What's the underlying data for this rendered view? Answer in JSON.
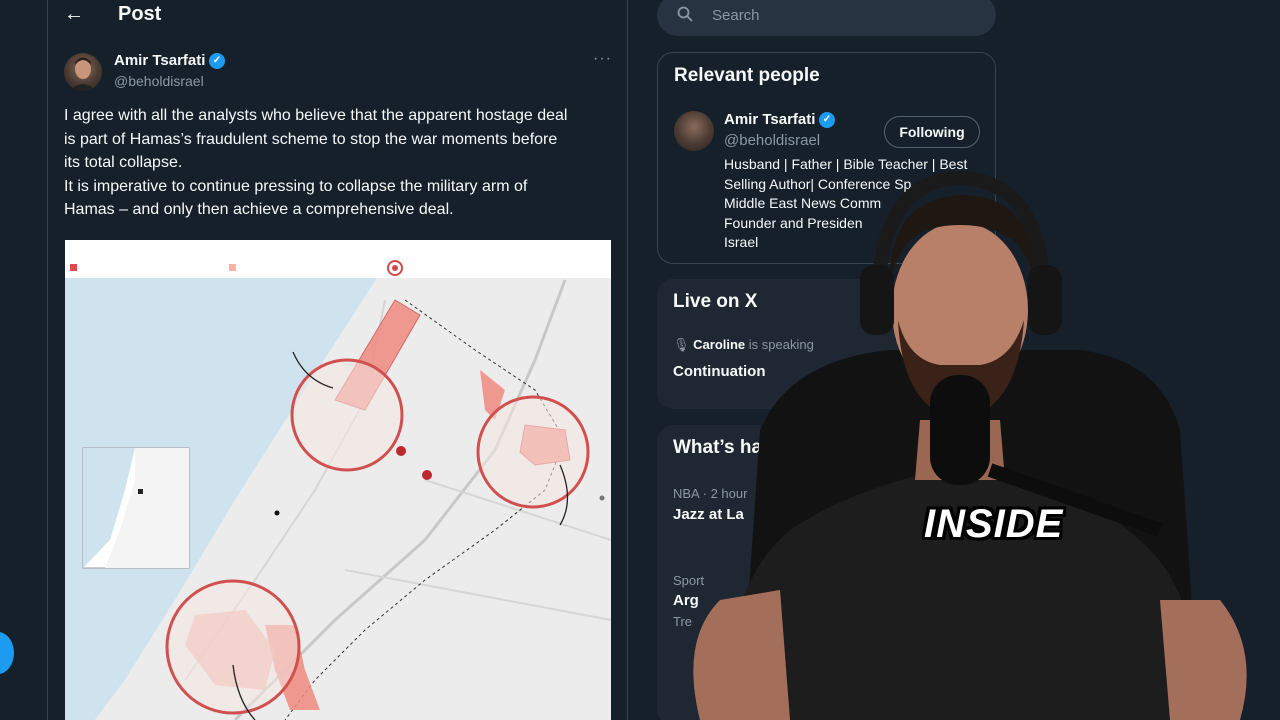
{
  "header": {
    "title": "Post"
  },
  "post": {
    "author_name": "Amir Tsarfati",
    "author_handle": "@beholdisrael",
    "text_lines": [
      "I agree with all the analysts who believe that the apparent hostage deal",
      "is part of Hamas’s fraudulent scheme to stop the war moments before",
      "its total collapse.",
      "It is imperative to continue pressing to collapse the military arm of",
      "Hamas – and only then achieve a comprehensive deal."
    ]
  },
  "search": {
    "placeholder": "Search"
  },
  "relevant_people": {
    "title": "Relevant people",
    "name": "Amir Tsarfati",
    "handle": "@beholdisrael",
    "follow_label": "Following",
    "bio_lines": [
      "Husband | Father | Bible Teacher | Best",
      "Selling Author| Conference Sp",
      "Middle East News Comm",
      "Founder and Presiden",
      "Israel"
    ]
  },
  "live": {
    "title": "Live on X",
    "speaker": "Caroline",
    "speaking_suffix": " is speaking",
    "topic": "Continuation"
  },
  "trends": {
    "title": "What’s ha",
    "items": [
      {
        "meta": "NBA · 2 hour",
        "title": "Jazz at La"
      },
      {
        "meta": "Sport",
        "title": "Arg",
        "sub": "Tre"
      }
    ]
  },
  "caption": {
    "text": "INSIDE"
  },
  "colors": {
    "bg": "#15202b",
    "accent": "#1d9bf0",
    "border": "#38444d",
    "muted": "#8b98a5"
  },
  "icons": [
    "back-arrow-icon",
    "verified-icon",
    "more-icon",
    "search-icon",
    "microphone-icon"
  ]
}
